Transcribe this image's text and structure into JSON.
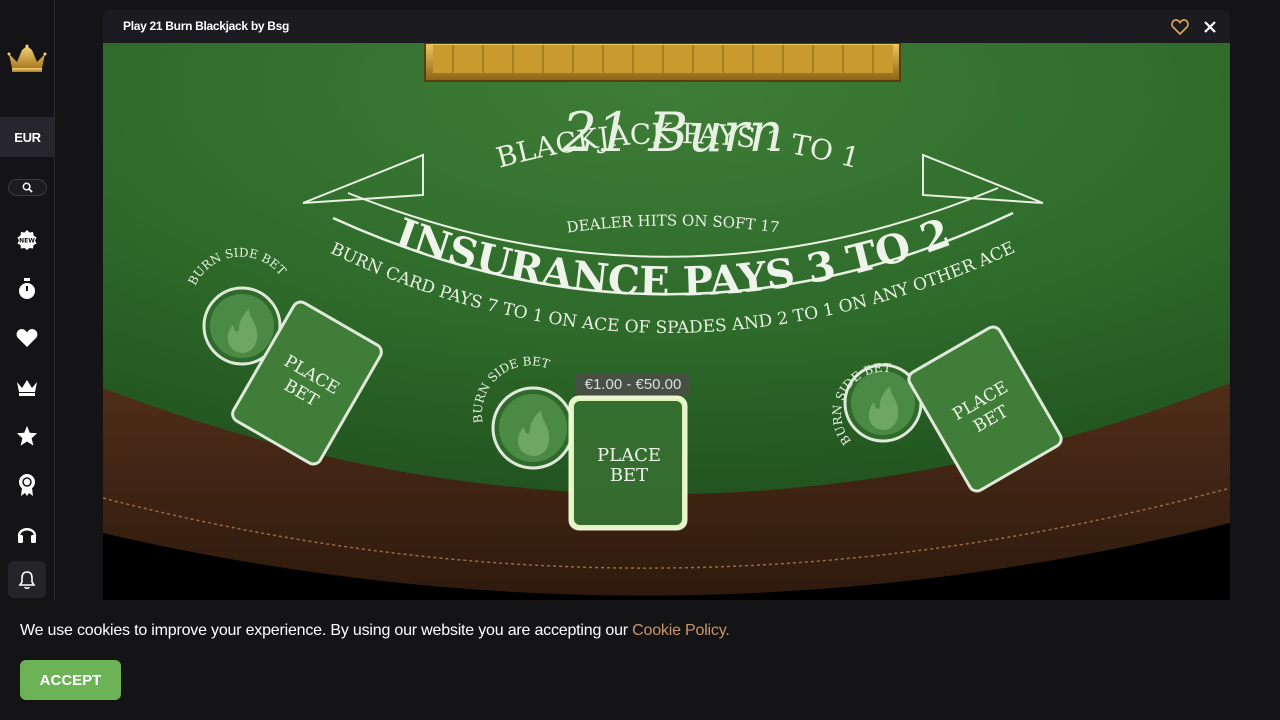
{
  "sidebar": {
    "currency": "EUR",
    "nav_icons": [
      "new-badge-icon",
      "stopwatch-icon",
      "heart-icon",
      "crown-icon",
      "star-icon",
      "award-ribbon-icon",
      "headset-icon",
      "bell-icon"
    ]
  },
  "game": {
    "title": "Play 21 Burn Blackjack by Bsg",
    "table": {
      "game_name": "21 Burn",
      "blackjack_text": "BLACKJACK PAYS 1 TO 1",
      "dealer_text": "DEALER HITS ON SOFT 17",
      "insurance_text": "INSURANCE PAYS 3 TO 2",
      "burn_card_text": "BURN CARD PAYS 7 TO 1 ON ACE OF SPADES AND 2 TO 1 ON ANY OTHER ACE",
      "side_bet_label": "BURN SIDE BET",
      "place_bet_line1": "PLACE",
      "place_bet_line2": "BET",
      "bet_range": "€1.00 - €50.00"
    }
  },
  "cookie_banner": {
    "text": "We use cookies to improve your experience. By using our website you are accepting our ",
    "link_text": "Cookie Policy.",
    "accept_label": "ACCEPT"
  },
  "colors": {
    "felt": "#2f6a2c",
    "accent_gold": "#c9a24a",
    "accept_green": "#6cb256",
    "cookie_link": "#c8956a"
  }
}
